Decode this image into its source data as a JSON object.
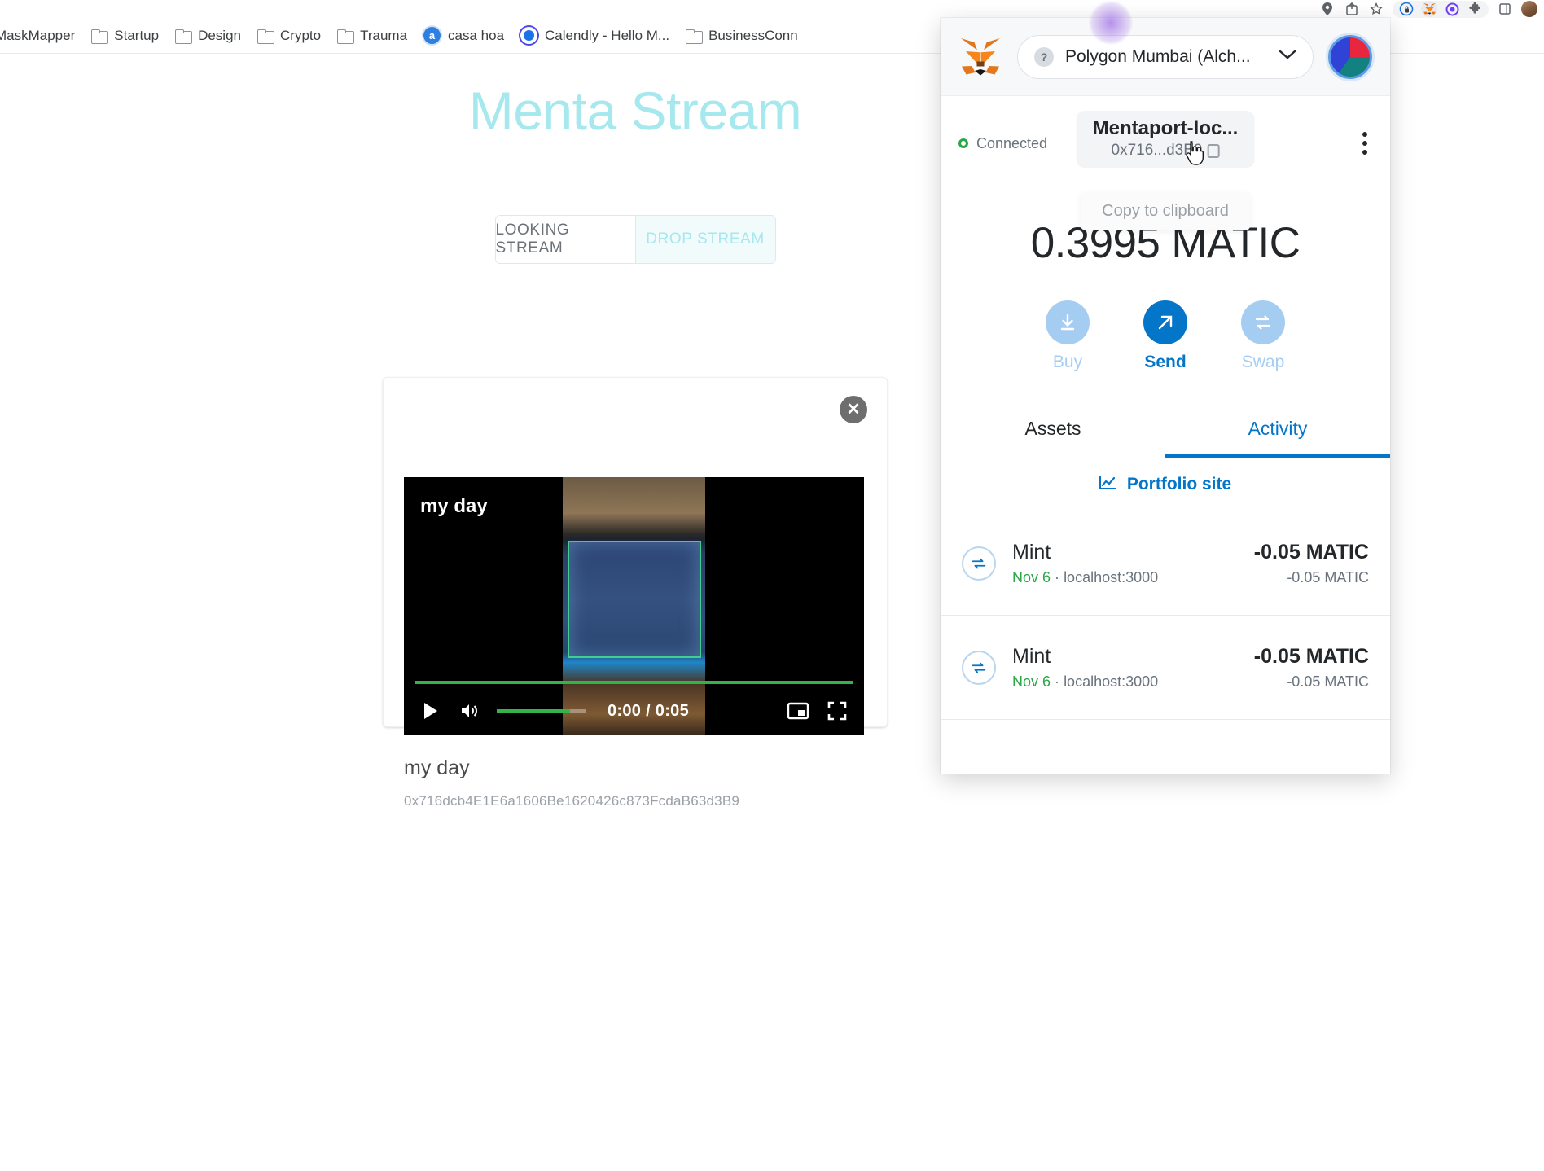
{
  "browser": {
    "toolbar_icons": [
      "location-pin-icon",
      "share-icon",
      "star-icon"
    ],
    "extension_icons": [
      "shield-lock-icon",
      "metamask-fox-icon",
      "purple-circle-icon",
      "puzzle-piece-icon",
      "sidebar-icon"
    ],
    "bookmarks": [
      {
        "label": "MaskMapper",
        "icon": "folder-icon",
        "type": "truncated"
      },
      {
        "label": "Startup",
        "icon": "folder-icon",
        "type": "folder"
      },
      {
        "label": "Design",
        "icon": "folder-icon",
        "type": "folder"
      },
      {
        "label": "Crypto",
        "icon": "folder-icon",
        "type": "folder"
      },
      {
        "label": "Trauma",
        "icon": "folder-icon",
        "type": "folder"
      },
      {
        "label": "casa hoa",
        "icon": "casa-favicon",
        "type": "site"
      },
      {
        "label": "Calendly - Hello M...",
        "icon": "calendly-favicon",
        "type": "site"
      },
      {
        "label": "BusinessConn",
        "icon": "folder-icon",
        "type": "folder"
      }
    ]
  },
  "page": {
    "title": "Menta Stream",
    "title_color": "#a5e8ee",
    "tabs": [
      {
        "label": "LOOKING STREAM",
        "active": false
      },
      {
        "label": "DROP STREAM",
        "active": true
      }
    ],
    "card": {
      "close_label": "✕",
      "video": {
        "overlay_title": "my day",
        "time_current": "0:00",
        "time_total": "0:05",
        "time_display": "0:00 / 0:05",
        "play_icon": "play-icon",
        "volume_icon": "volume-icon",
        "pip_icon": "picture-in-picture-icon",
        "fullscreen_icon": "fullscreen-icon",
        "progress_color": "#35b24a"
      },
      "caption": "my day",
      "address": "0x716dcb4E1E6a1606Be1620426c873FcdaB63d3B9"
    }
  },
  "metamask": {
    "network": "Polygon Mumbai (Alch...",
    "network_help_icon": "question-mark-icon",
    "network_chevron_icon": "chevron-down-icon",
    "fox_icon": "metamask-fox-icon",
    "identicon": "account-identicon",
    "connection_status": "Connected",
    "account_name": "Mentaport-loc...",
    "account_address": "0x716...d3B9",
    "copy_icon": "copy-icon",
    "kebab_icon": "more-options-icon",
    "tooltip": "Copy to clipboard",
    "balance": "0.3995 MATIC",
    "actions": [
      {
        "label": "Buy",
        "icon": "download-arrow-icon",
        "primary": false
      },
      {
        "label": "Send",
        "icon": "send-arrow-icon",
        "primary": true
      },
      {
        "label": "Swap",
        "icon": "swap-icon",
        "primary": false
      }
    ],
    "tabs": [
      {
        "label": "Assets",
        "active": false
      },
      {
        "label": "Activity",
        "active": true
      }
    ],
    "portfolio_link": "Portfolio site",
    "portfolio_icon": "chart-line-icon",
    "transactions": [
      {
        "title": "Mint",
        "date": "Nov 6",
        "origin": "localhost:3000",
        "separator": "·",
        "amount": "-0.05 MATIC",
        "amount_sub": "-0.05 MATIC",
        "icon": "swap-circle-icon"
      },
      {
        "title": "Mint",
        "date": "Nov 6",
        "origin": "localhost:3000",
        "separator": "·",
        "amount": "-0.05 MATIC",
        "amount_sub": "-0.05 MATIC",
        "icon": "swap-circle-icon"
      }
    ]
  },
  "colors": {
    "accent_blue": "#0376c9",
    "accent_cyan": "#a5e8ee",
    "green": "#28a745",
    "video_green": "#35b24a"
  }
}
